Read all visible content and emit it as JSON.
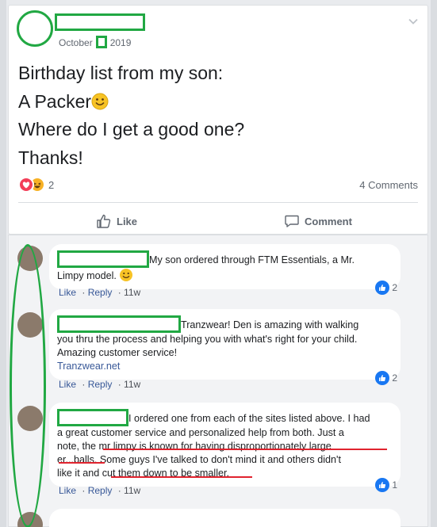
{
  "post": {
    "date_month": "October",
    "date_year": "2019",
    "lines": [
      "Birthday list from my son:",
      "A Packer",
      "Where do I get a good one?",
      "Thanks!"
    ],
    "reaction_count": "2",
    "comments_count": "4 Comments"
  },
  "actions": {
    "like_label": "Like",
    "comment_label": "Comment"
  },
  "comments": [
    {
      "text_a": "My son ordered through FTM Essentials, a Mr.",
      "text_b": "Limpy model.",
      "like": "Like",
      "reply": "Reply",
      "time": "11w",
      "likes": "2"
    },
    {
      "text_a": "Tranzwear! Den is amazing with walking",
      "text_b": "you thru the process and helping you with what's right for your child.",
      "text_c": "Amazing customer service!",
      "link": "Tranzwear.net",
      "like": "Like",
      "reply": "Reply",
      "time": "11w",
      "likes": "2"
    },
    {
      "text_a": "I ordered one from each of the sites listed above. I had",
      "text_b": "a great customer service and personalized help from both. Just a",
      "text_c": "note, the mr limpy is known for having disproportionately large",
      "text_d": "er...balls. Some guys I've talked to don't mind it and others didn't",
      "text_e": "like it and cut them down to be smaller.",
      "like": "Like",
      "reply": "Reply",
      "time": "11w",
      "likes": "1"
    }
  ],
  "colors": {
    "annotation_green": "#21a843",
    "annotation_red": "#e0232e",
    "link_blue": "#385898",
    "like_blue": "#1877f2"
  }
}
